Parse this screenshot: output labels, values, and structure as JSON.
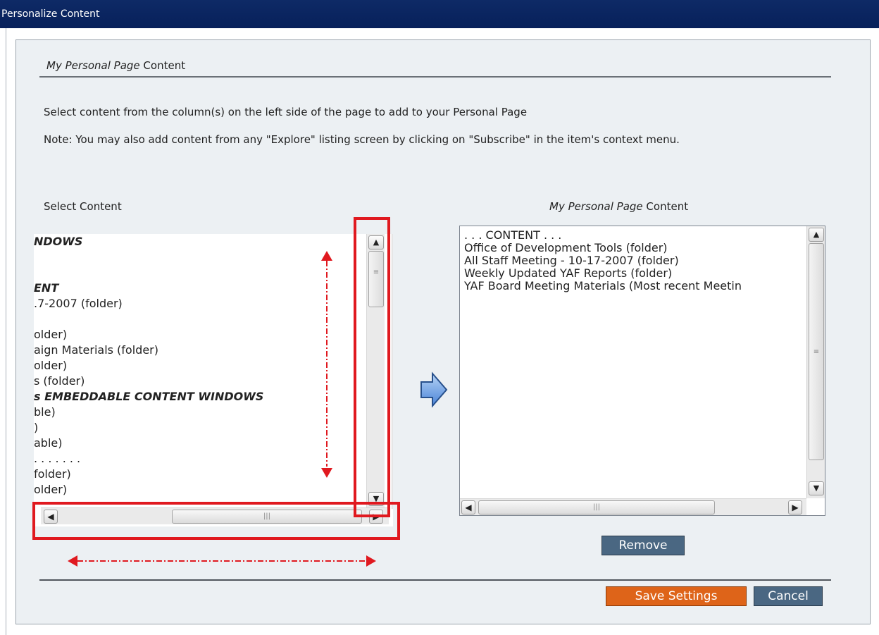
{
  "window": {
    "title": "Personalize Content"
  },
  "section": {
    "heading_italic": "My Personal Page",
    "heading_rest": " Content",
    "intro": "Select content from the column(s) on the left side of the page to add to your Personal Page",
    "note": "Note: You may also add content from any \"Explore\" listing screen by clicking on \"Subscribe\" in the item's context menu."
  },
  "left": {
    "label": "Select Content",
    "items": [
      {
        "text": "NDOWS",
        "bold": true
      },
      {
        "text": "",
        "bold": false
      },
      {
        "text": "",
        "bold": false
      },
      {
        "text": "ENT",
        "bold": true
      },
      {
        "text": ".7-2007 (folder)",
        "bold": false
      },
      {
        "text": "",
        "bold": false
      },
      {
        "text": "older)",
        "bold": false
      },
      {
        "text": "aign Materials (folder)",
        "bold": false
      },
      {
        "text": "older)",
        "bold": false
      },
      {
        "text": "s (folder)",
        "bold": false
      },
      {
        "text": "s EMBEDDABLE CONTENT WINDOWS",
        "bold": true
      },
      {
        "text": "ble)",
        "bold": false
      },
      {
        "text": ")",
        "bold": false
      },
      {
        "text": "able)",
        "bold": false
      },
      {
        "text": ". . . . . . .",
        "bold": false
      },
      {
        "text": "folder)",
        "bold": false
      },
      {
        "text": "older)",
        "bold": false
      }
    ]
  },
  "right": {
    "label_italic": "My Personal Page",
    "label_rest": " Content",
    "items": [
      ". . . CONTENT . . .",
      "Office of Development Tools (folder)",
      "All Staff Meeting - 10-17-2007 (folder)",
      "Weekly Updated YAF Reports (folder)",
      "YAF Board Meeting Materials (Most recent Meetin"
    ]
  },
  "buttons": {
    "remove": "Remove",
    "save": "Save Settings",
    "cancel": "Cancel"
  },
  "colors": {
    "titlebar": "#0e2a66",
    "save_button": "#de6419",
    "secondary_button": "#4a6782",
    "highlight": "#e0191f"
  }
}
